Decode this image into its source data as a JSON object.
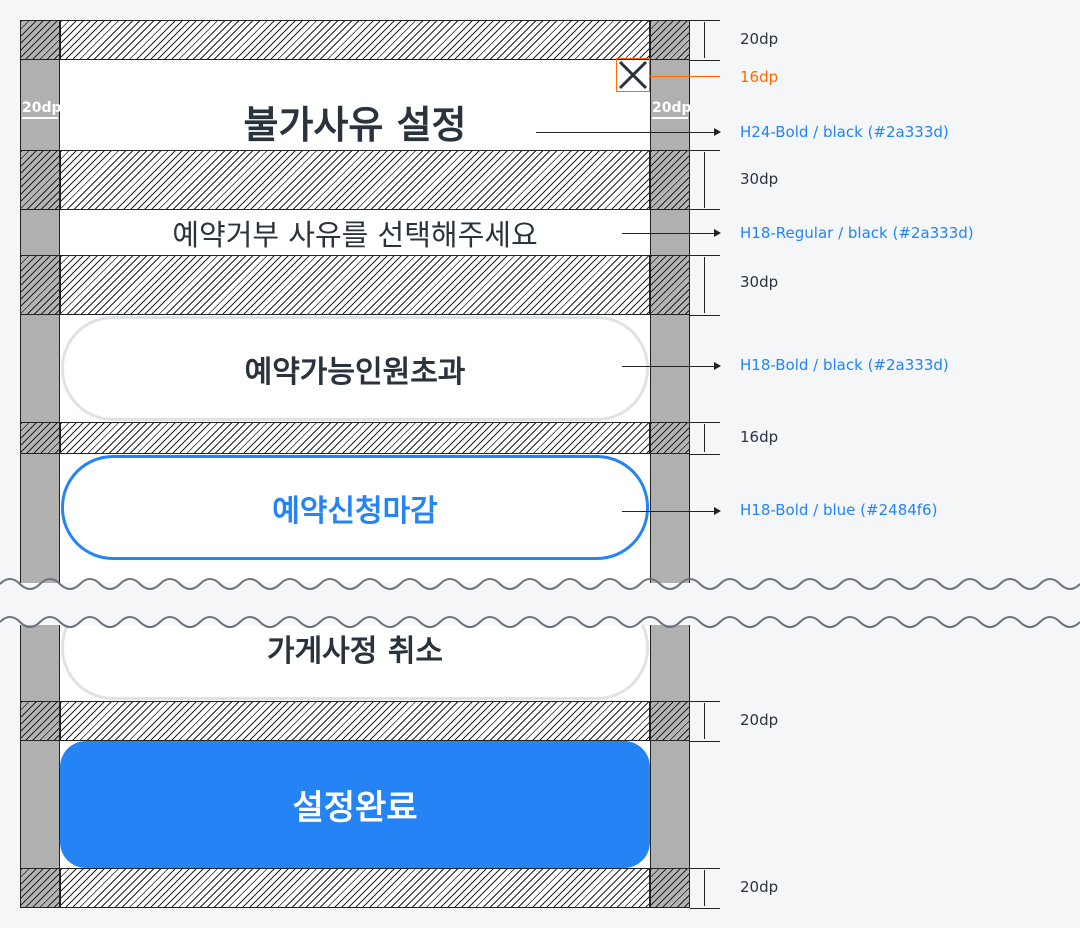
{
  "modal": {
    "title": "불가사유 설정",
    "subtitle": "예약거부 사유를 선택해주세요",
    "options": [
      "예약가능인원초과",
      "예약신청마감",
      "가게사정 취소"
    ],
    "confirm_label": "설정완료",
    "close_icon": "close-icon"
  },
  "padding_labels": {
    "left": "20dp",
    "right": "20dp"
  },
  "spacing_specs": {
    "top": "20dp",
    "close_size": "16dp",
    "after_title": "30dp",
    "after_subtitle": "30dp",
    "between_options": "16dp",
    "before_button": "20dp",
    "bottom": "20dp"
  },
  "typography_specs": {
    "title": "H24-Bold / black (#2a333d)",
    "subtitle": "H18-Regular / black (#2a333d)",
    "option_default": "H18-Bold / black (#2a333d)",
    "option_selected": "H18-Bold / blue (#2484f6)"
  },
  "colors": {
    "text": "#2a333d",
    "accent": "#2484f6",
    "border_default": "#dfe3e6",
    "spec_highlight": "#ff6a00"
  }
}
